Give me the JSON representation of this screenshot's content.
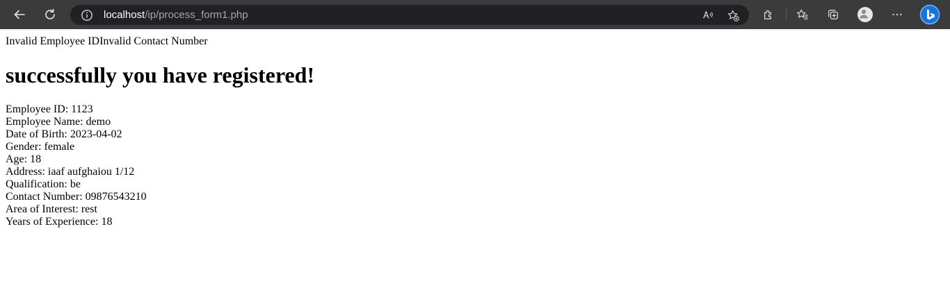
{
  "browser": {
    "url_host": "localhost",
    "url_path": "/ip/process_form1.php",
    "icons": {
      "back": "back-arrow-icon",
      "reload": "reload-icon",
      "site_info": "info-icon",
      "read_aloud": "read-aloud-icon",
      "add_favorite": "star-plus-icon",
      "extensions": "puzzle-icon",
      "favorites": "favorites-icon",
      "collections": "collections-icon",
      "profile": "profile-avatar",
      "more": "more-dots-icon",
      "copilot": "bing-copilot-icon"
    }
  },
  "page": {
    "error_line": "Invalid Employee IDInvalid Contact Number",
    "heading": "successfully you have registered!",
    "details": [
      "Employee ID: 1123",
      "Employee Name: demo",
      "Date of Birth: 2023-04-02",
      "Gender: female",
      "Age: 18",
      "Address: iaaf aufghaiou 1/12",
      "Qualification: be",
      "Contact Number: 09876543210",
      "Area of Interest: rest",
      "Years of Experience: 18"
    ]
  }
}
